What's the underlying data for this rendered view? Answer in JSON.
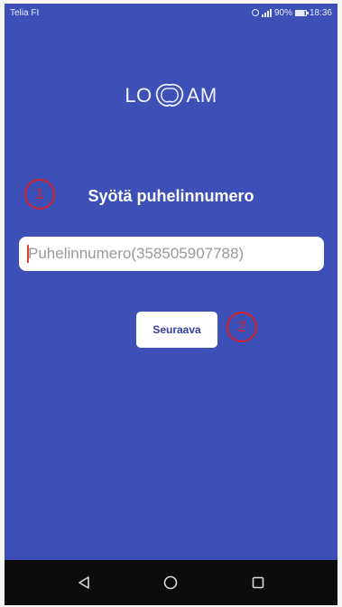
{
  "status_bar": {
    "carrier": "Telia FI",
    "battery_percent": "90%",
    "time": "18:36"
  },
  "logo": {
    "text_left": "LO",
    "text_right": "AM"
  },
  "title": "Syötä puhelinnumero",
  "phone_input": {
    "value": "",
    "placeholder": "Puhelinnumero(358505907788)"
  },
  "next_button": {
    "label": "Seuraava"
  },
  "annotations": {
    "one": "1",
    "two": "2"
  },
  "nav_bar": {
    "back_icon": "back-triangle-icon",
    "home_icon": "home-circle-icon",
    "recents_icon": "recents-square-icon"
  },
  "colors": {
    "background": "#3d50b8",
    "annotation": "#d8232a",
    "button_text": "#2f3ea8"
  }
}
